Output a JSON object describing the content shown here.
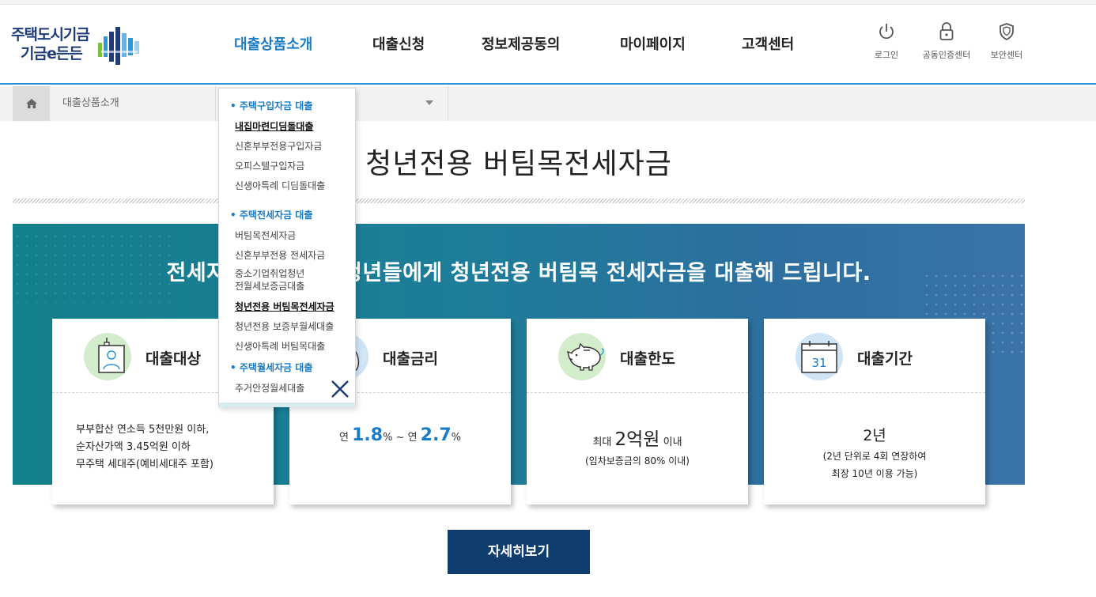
{
  "logo": {
    "line1": "주택도시기금",
    "line2": "기금e든든"
  },
  "gnb": [
    {
      "label": "대출상품소개",
      "active": true
    },
    {
      "label": "대출신청",
      "active": false
    },
    {
      "label": "정보제공동의",
      "active": false
    },
    {
      "label": "마이페이지",
      "active": false
    },
    {
      "label": "고객센터",
      "active": false
    }
  ],
  "util": [
    {
      "label": "로그인",
      "icon": "power-icon"
    },
    {
      "label": "공동인증센터",
      "icon": "lock-icon"
    },
    {
      "label": "보안센터",
      "icon": "shield-icon"
    }
  ],
  "breadcrumb": {
    "home_icon": "home-icon",
    "level1": "대출상품소개"
  },
  "page_title": "청년전용 버팀목전세자금",
  "banner": {
    "message": "전세자금이 부족한 청년들에게 청년전용 버팀목 전세자금을 대출해 드립니다."
  },
  "dropdown": {
    "sections": [
      {
        "title": "주택구입자금 대출",
        "items": [
          "내집마련디딤돌대출",
          "신혼부부전용구입자금",
          "오피스텔구입자금",
          "신생아특례 디딤돌대출"
        ]
      },
      {
        "title": "주택전세자금 대출",
        "items": [
          "버팀목전세자금",
          "신혼부부전용 전세자금",
          "중소기업취업청년\n전월세보증금대출",
          "청년전용 버팀목전세자금",
          "청년전용 보증부월세대출",
          "신생아특례 버팀목대출"
        ]
      },
      {
        "title": "주택월세자금 대출",
        "items": [
          "주거안정월세대출"
        ]
      }
    ],
    "close_icon": "close-icon"
  },
  "cards": [
    {
      "title": "대출대상",
      "icon": "person-badge-icon",
      "lines": [
        "부부합산 연소득 5천만원 이하,",
        "순자산가액 3.45억원 이하",
        "무주택 세대주(예비세대주 포함)"
      ]
    },
    {
      "title": "대출금리",
      "icon": "money-bag-icon",
      "prefix1": "연 ",
      "rate1": "1.8",
      "unit1": "% ~ 연 ",
      "rate2": "2.7",
      "unit2": "%"
    },
    {
      "title": "대출한도",
      "icon": "piggy-bank-icon",
      "pre": "최대 ",
      "amount": "2억원",
      "post": " 이내",
      "note": "(임차보증금의 80% 이내)"
    },
    {
      "title": "대출기간",
      "icon": "calendar-icon",
      "calendar_day": "31",
      "period": "2년",
      "note1": "(2년 단위로 4회 연장하여",
      "note2": "최장 10년 이용 가능)"
    }
  ],
  "more_button": "자세히보기",
  "colors": {
    "accent": "#1a7cc6",
    "navy": "#0f3d6e",
    "banner": "#127f8c"
  }
}
